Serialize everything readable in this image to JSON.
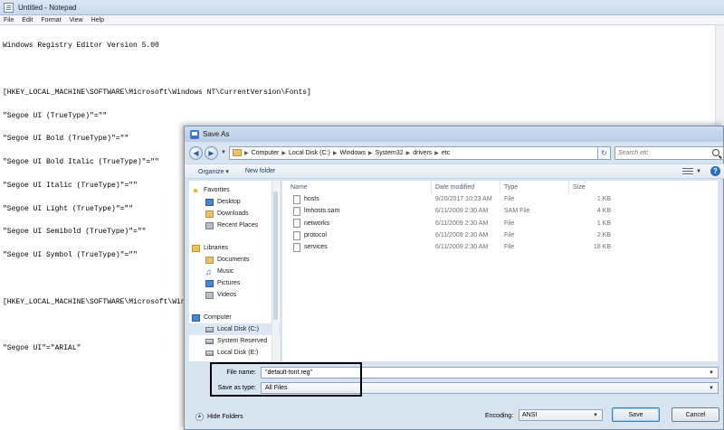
{
  "notepad": {
    "title": "Untitled - Notepad",
    "menu": [
      "File",
      "Edit",
      "Format",
      "View",
      "Help"
    ],
    "lines": [
      "Windows Registry Editor Version 5.00",
      "",
      "[HKEY_LOCAL_MACHINE\\SOFTWARE\\Microsoft\\Windows NT\\CurrentVersion\\Fonts]",
      "\"Segoe UI (TrueType)\"=\"\"",
      "\"Segoe UI Bold (TrueType)\"=\"\"",
      "\"Segoe UI Bold Italic (TrueType)\"=\"\"",
      "\"Segoe UI Italic (TrueType)\"=\"\"",
      "\"Segoe UI Light (TrueType)\"=\"\"",
      "\"Segoe UI Semibold (TrueType)\"=\"\"",
      "\"Segoe UI Symbol (TrueType)\"=\"\"",
      "",
      "[HKEY_LOCAL_MACHINE\\SOFTWARE\\Microsoft\\Windows NT\\CurrentVersion\\FontSubstitutes]",
      "",
      "\"Segoe UI\"=\"ARIAL\""
    ]
  },
  "dialog": {
    "title": "Save As",
    "breadcrumb": [
      "Computer",
      "Local Disk (C:)",
      "Windows",
      "System32",
      "drivers",
      "etc"
    ],
    "search_placeholder": "Search etc",
    "toolbar": {
      "organize": "Organize ▾",
      "new_folder": "New folder"
    },
    "nav": {
      "favorites": {
        "label": "Favorites",
        "items": [
          "Desktop",
          "Downloads",
          "Recent Places"
        ]
      },
      "libraries": {
        "label": "Libraries",
        "items": [
          "Documents",
          "Music",
          "Pictures",
          "Videos"
        ]
      },
      "computer": {
        "label": "Computer",
        "items": [
          "Local Disk (C:)",
          "System Reserved",
          "Local Disk (E:)"
        ]
      }
    },
    "columns": {
      "name": "Name",
      "date": "Date modified",
      "type": "Type",
      "size": "Size"
    },
    "files": [
      {
        "name": "hosts",
        "date": "9/20/2017 10:23 AM",
        "type": "File",
        "size": "1 KB"
      },
      {
        "name": "lmhosts.sam",
        "date": "6/11/2009 2:30 AM",
        "type": "SAM File",
        "size": "4 KB"
      },
      {
        "name": "networks",
        "date": "6/11/2009 2:30 AM",
        "type": "File",
        "size": "1 KB"
      },
      {
        "name": "protocol",
        "date": "6/11/2009 2:30 AM",
        "type": "File",
        "size": "2 KB"
      },
      {
        "name": "services",
        "date": "6/11/2009 2:30 AM",
        "type": "File",
        "size": "18 KB"
      }
    ],
    "file_name_label": "File name:",
    "file_name_value": "\"default-font.reg\"",
    "save_type_label": "Save as type:",
    "save_type_value": "All Files",
    "hide_folders": "Hide Folders",
    "encoding_label": "Encoding:",
    "encoding_value": "ANSI",
    "save_button": "Save",
    "cancel_button": "Cancel"
  }
}
